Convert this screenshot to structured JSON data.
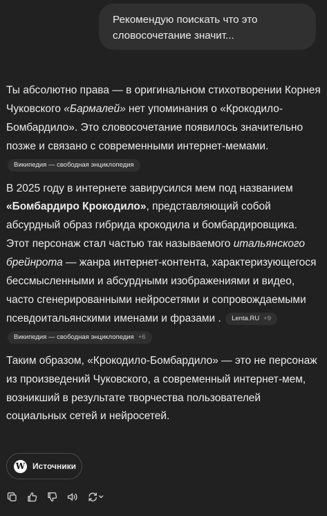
{
  "user_message": "Рекомендую поискать что это словосочетание значит...",
  "assistant": {
    "p1": {
      "t1": "Ты абсолютно права — в оригинальном стихотворении Корнея Чуковского ",
      "t2": "«Бармалей»",
      "t3": " нет упоминания о «Крокодило-Бомбардило». Это словосочетание появилось значительно позже и связано с современными интернет-мемами.",
      "chip": {
        "label": "Википедия — свободная энциклопедия"
      }
    },
    "p2": {
      "t1": "В 2025 году в интернете завирусился мем под названием ",
      "t2": "«Бомбардиро Крокодило»",
      "t3": ", представляющий собой абсурдный образ гибрида крокодила и бомбардировщика. Этот персонаж стал частью так называемого ",
      "t4": "итальянского брейнрота",
      "t5": " — жанра интернет-контента, характеризующегося бессмысленными и абсурдными изображениями и видео, часто сгенерированными нейросетями и сопровождаемыми псевдоитальянскими именами и фразами .",
      "chip1": {
        "label": "Lenta.RU",
        "more": "+9"
      },
      "chip2": {
        "label": "Википедия — свободная энциклопедия",
        "more": "+6"
      }
    },
    "p3": "Таким образом, «Крокодило-Бомбардило» — это не персонаж из произведений Чуковского, а современный интернет-мем, возникший в результате творчества пользователей социальных сетей и нейросетей."
  },
  "sources_button": {
    "label": "Источники",
    "logo_letter": "W"
  },
  "actions": [
    "copy-icon",
    "thumbs-up-icon",
    "thumbs-down-icon",
    "speaker-icon",
    "regenerate-icon"
  ]
}
